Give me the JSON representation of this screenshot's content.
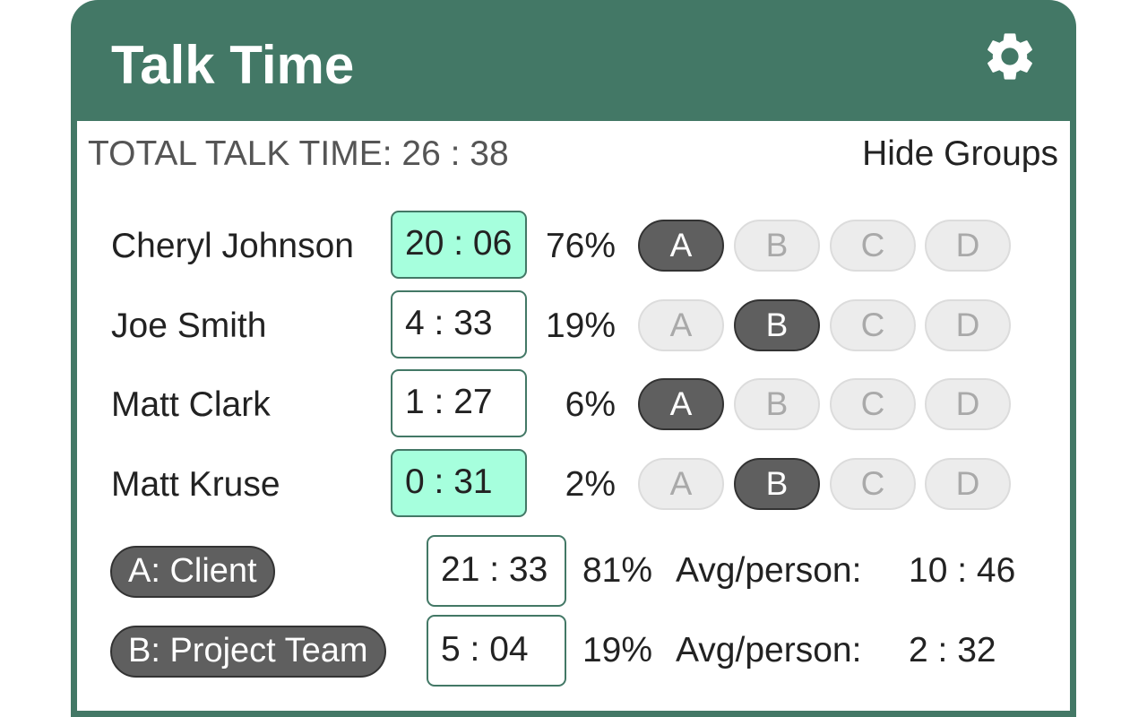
{
  "header": {
    "title": "Talk Time",
    "settings_icon": "gear-icon"
  },
  "total": {
    "label": "TOTAL TALK TIME:",
    "value": "26 : 38"
  },
  "hide_groups_label": "Hide Groups",
  "group_letters": [
    "A",
    "B",
    "C",
    "D"
  ],
  "people": [
    {
      "name": "Cheryl Johnson",
      "time": "20 : 06",
      "percent": "76%",
      "active": true,
      "group": "A"
    },
    {
      "name": "Joe Smith",
      "time": "4 : 33",
      "percent": "19%",
      "active": false,
      "group": "B"
    },
    {
      "name": "Matt Clark",
      "time": "1 : 27",
      "percent": "6%",
      "active": false,
      "group": "A"
    },
    {
      "name": "Matt Kruse",
      "time": "0 : 31",
      "percent": "2%",
      "active": true,
      "group": "B"
    }
  ],
  "groups": [
    {
      "label": "A: Client",
      "time": "21 : 33",
      "percent": "81%",
      "avg_label": "Avg/person:",
      "avg_value": "10 : 46"
    },
    {
      "label": "B: Project Team",
      "time": "5 : 04",
      "percent": "19%",
      "avg_label": "Avg/person:",
      "avg_value": "2 : 32"
    }
  ],
  "colors": {
    "header_bg": "#437866",
    "active_time_bg": "#a6ffdd",
    "selected_group_bg": "#5f5f5f",
    "unselected_group_bg": "#ececec"
  }
}
